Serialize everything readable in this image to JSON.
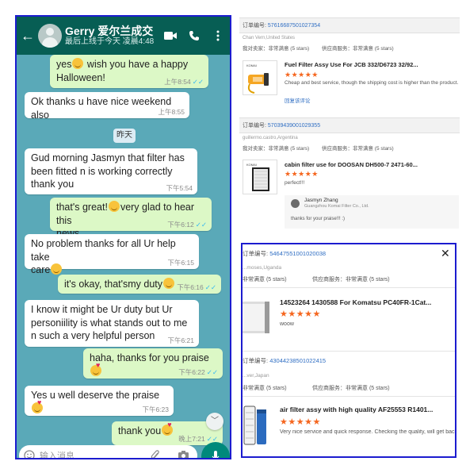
{
  "chat": {
    "contact_name": "Gerry 爱尔兰成交",
    "last_seen": "最后上线于今天 凌晨4:48",
    "date_chip": "昨天",
    "input_placeholder": "输入消息",
    "messages": [
      {
        "dir": "out",
        "text": "yes😊 wish you have a happy Halloween!",
        "l1": "yes",
        "l2": " wish you have a happy",
        "l3": "Halloween!",
        "time": "上午8:54",
        "read": true
      },
      {
        "dir": "in",
        "text": "Ok thanks u have nice weekend also",
        "time": "上午8:55"
      },
      {
        "dir": "in",
        "text": "Gud morning Jasmyn that filter has been fitted n is working correctly thank you",
        "l1": "Gud morning Jasmyn that filter has",
        "l2": "been fitted n is working correctly",
        "l3": "thank you",
        "time": "下午5:54"
      },
      {
        "dir": "out",
        "text": "that's great!😊very glad to hear this news",
        "l1": "that's great!",
        "l2": "very glad to hear this",
        "l3": "news",
        "time": "下午6:12",
        "read": true
      },
      {
        "dir": "in",
        "text": "No problem thanks for all Ur help take care😊",
        "l1": "No problem thanks for all Ur help take",
        "l2": "care",
        "time": "下午6:15"
      },
      {
        "dir": "out",
        "text": "it's okay, that'smy duty😊",
        "l1": "it's okay, that'smy duty",
        "time": "下午6:16",
        "read": true
      },
      {
        "dir": "in",
        "text": "I know it might be Ur duty but Ur personiility is what stands out to me n such a very helpful person",
        "l1": "I know it might be Ur duty but Ur",
        "l2": "personiility is what stands out to me",
        "l3": "n such a very helpful person",
        "time": "下午6:21"
      },
      {
        "dir": "out",
        "text": "haha, thanks for you praise🥰",
        "l1": "haha, thanks for you praise",
        "time": "下午6:22",
        "read": true
      },
      {
        "dir": "in",
        "text": "Yes u well deserve the praise😘",
        "l1": "Yes u well deserve the praise",
        "time": "下午6:23"
      },
      {
        "dir": "out",
        "text": "thank you🥰",
        "l1": "thank you",
        "time": "晚上7:21",
        "read": true
      }
    ]
  },
  "orders": [
    {
      "order_label": "订单编号:",
      "order_number": "57616687501027354",
      "buyer": "Chan Vern,United States",
      "rate_text": "我对卖家：非常满意   (5 stars)",
      "supplier_text": "供应商服务：非常满意   (5 stars)",
      "product_title": "Fuel Filter Assy Use For JCB 332/D6723 32/92...",
      "stars": "★★★★★",
      "review": "Cheap and best service, though the shipping cost is higher than the product.",
      "reply_link": "回复该评论"
    },
    {
      "order_label": "订单编号:",
      "order_number": "57039439001029355",
      "buyer": "guillermo.castro,Argentina",
      "rate_text": "我对卖家：非常满意   (5 stars)",
      "supplier_text": "供应商服务：非常满意   (5 stars)",
      "product_title": "cabin filter use for DOOSAN DH500-7 2471-60...",
      "stars": "★★★★★",
      "review": "perfect!!!",
      "seller_name": "Jasmyn Zhang",
      "seller_company": "Guangzhou Komai Filter Co., Ltd.",
      "seller_reply": "thanks for your praise!!! :)"
    }
  ],
  "dialog": {
    "entries": [
      {
        "order_label": "订单编号:",
        "order_number": "54647551001020038",
        "buyer": "...moses,Uganda",
        "rate_text": "非常满意   (5 stars)",
        "supplier_text": "供应商服务：非常满意   (5 stars)",
        "product_title": "14523264 1430588 For Komatsu PC40FR-1Cat...",
        "stars": "★★★★★",
        "review": "woow"
      },
      {
        "order_label": "订单编号:",
        "order_number": "43044238501022415",
        "buyer": "...ver,Japan",
        "rate_text": "非常满意   (5 stars)",
        "supplier_text": "供应商服务：非常满意   (5 stars)",
        "product_title": "air filter assy with high quality AF25553 R1401...",
        "stars": "★★★★★",
        "review": "Very nice service and quick response. Checking the quality, will get back to you"
      }
    ],
    "close_label": "✕"
  },
  "colors": {
    "wa_header": "#075e54",
    "chat_bg": "#5aa9b8",
    "bubble_out": "#dcf8c6",
    "stars": "#f5661f",
    "link": "#2f6ec3",
    "frame": "#1c1ccf"
  }
}
